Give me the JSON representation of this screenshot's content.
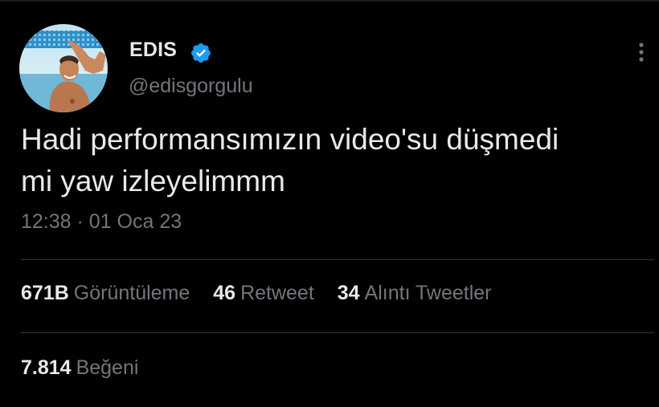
{
  "author": {
    "name": "EDIS",
    "handle": "@edisgorgulu",
    "verified": true,
    "avatar_icon": "profile-photo"
  },
  "tweet": {
    "text_lines": [
      "Hadi performansımızın video'su düşmedi",
      "mi yaw izleyelimmm"
    ],
    "time": "12:38",
    "separator": "·",
    "date": "01 Oca 23"
  },
  "stats": {
    "views": {
      "count": "671B",
      "label": "Görüntüleme"
    },
    "retweets": {
      "count": "46",
      "label": "Retweet"
    },
    "quotes": {
      "count": "34",
      "label": "Alıntı Tweetler"
    },
    "likes": {
      "count": "7.814",
      "label": "Beğeni"
    }
  },
  "colors": {
    "background": "#000000",
    "text_primary": "#e7e9ea",
    "text_secondary": "#71767b",
    "divider": "#2f3336",
    "verified_badge": "#1d9bf0"
  },
  "icons": {
    "verified": "verified-badge-icon",
    "more": "more-options-icon"
  }
}
